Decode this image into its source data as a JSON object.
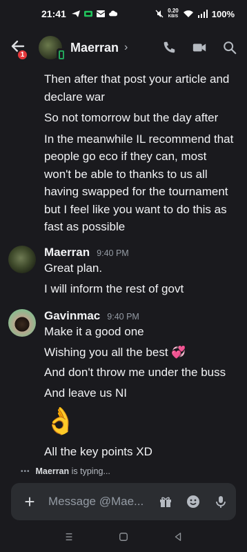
{
  "status_bar": {
    "time": "21:41",
    "net_speed_value": "0.20",
    "net_speed_unit": "KB/S",
    "battery": "100%"
  },
  "header": {
    "unread_count": "1",
    "contact_name": "Maerran",
    "chevron": "›"
  },
  "messages": {
    "continued_lines": [
      "Then after that post your article and",
      "declare war",
      "So not tomorrow but the day after",
      "In the meanwhile IL recommend that",
      "people go eco if they can, most",
      "won't be able to thanks to us all",
      "having swapped for the tournament",
      "but I feel like you want to do this as",
      "fast as possible"
    ],
    "group1": {
      "author": "Maerran",
      "timestamp": "9:40 PM",
      "lines": [
        "Great plan.",
        "I will inform the rest of govt"
      ]
    },
    "group2": {
      "author": "Gavinmac",
      "timestamp": "9:40 PM",
      "lines": [
        "Make it a good one",
        "Wishing you all the best 💞",
        "And don't throw me under the buss",
        "And leave us NI"
      ],
      "emoji": "👌",
      "after_emoji": "All the key points XD"
    }
  },
  "typing": {
    "dots": "•••",
    "user": "Maerran",
    "suffix": " is typing..."
  },
  "composer": {
    "placeholder": "Message @Mae..."
  },
  "colors": {
    "background": "#1a1a1e",
    "composer": "#2b2d31",
    "online": "#23a55a",
    "badge": "#e5383b"
  }
}
